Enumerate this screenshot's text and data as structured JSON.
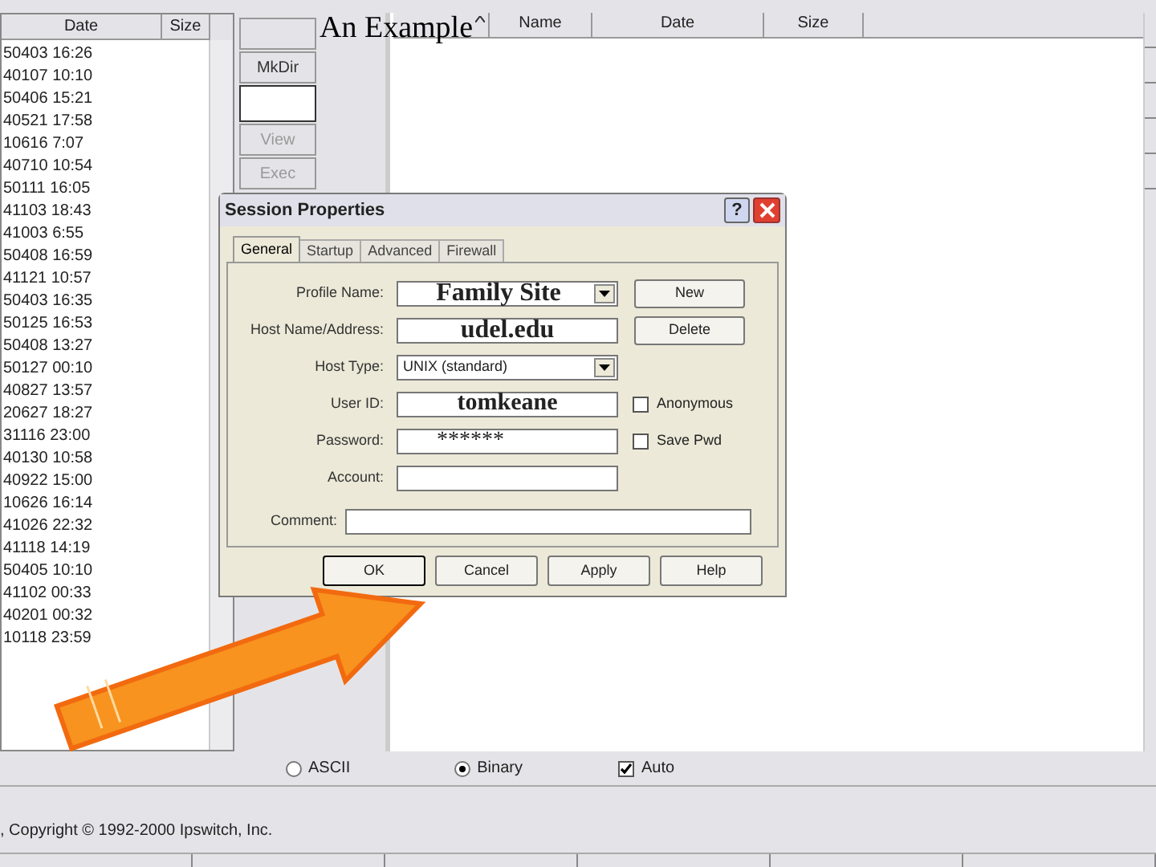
{
  "slide_title": "An Example",
  "local_pane": {
    "columns": [
      "Date",
      "Size"
    ],
    "rows": [
      "50403 16:26",
      "40107 10:10",
      "50406 15:21",
      "40521 17:58",
      "10616 7:07",
      "40710 10:54",
      "50111 16:05",
      "41103 18:43",
      "41003 6:55",
      "50408 16:59",
      "41121 10:57",
      "50403 16:35",
      "50125 16:53",
      "50408 13:27",
      "50127 00:10",
      "40827 13:57",
      "20627 18:27",
      "31116 23:00",
      "40130 10:58",
      "40922 15:00",
      "10626 16:14",
      "41026 22:32",
      "41118 14:19",
      "50405 10:10",
      "41102 00:33",
      "40201 00:32",
      "10118 23:59"
    ]
  },
  "side_buttons": [
    {
      "label": "MkDir",
      "disabled": false
    },
    {
      "label": "View",
      "disabled": true
    },
    {
      "label": "Exec",
      "disabled": true
    }
  ],
  "remote_pane": {
    "columns": [
      "Name",
      "Date",
      "Size"
    ]
  },
  "transfer_modes": [
    {
      "label": "ASCII",
      "selected": false
    },
    {
      "label": "Binary",
      "selected": true
    }
  ],
  "auto": {
    "label": "Auto",
    "checked": true
  },
  "status": ", Copyright © 1992-2000 Ipswitch, Inc.",
  "dialog": {
    "title": "Session Properties",
    "help_label": "?",
    "tabs": [
      {
        "label": "General",
        "selected": true
      },
      {
        "label": "Startup",
        "selected": false
      },
      {
        "label": "Advanced",
        "selected": false
      },
      {
        "label": "Firewall",
        "selected": false
      }
    ],
    "fields": [
      {
        "label": "Profile Name:",
        "value": "Family Site",
        "kind": "combo"
      },
      {
        "label": "Host Name/Address:",
        "value": "udel.edu",
        "kind": "text"
      },
      {
        "label": "Host Type:",
        "value": "UNIX (standard)",
        "kind": "combo"
      },
      {
        "label": "User ID:",
        "value": "tomkeane",
        "kind": "text"
      },
      {
        "label": "Password:",
        "value": "******",
        "kind": "text"
      },
      {
        "label": "Account:",
        "kind": "text"
      }
    ],
    "side_buttons": [
      "New",
      "Delete"
    ],
    "checkboxes": [
      {
        "label": "Anonymous",
        "checked": false
      },
      {
        "label": "Save Pwd",
        "checked": false
      }
    ],
    "comment_label": "Comment:",
    "buttons": [
      "OK",
      "Cancel",
      "Apply",
      "Help"
    ]
  }
}
